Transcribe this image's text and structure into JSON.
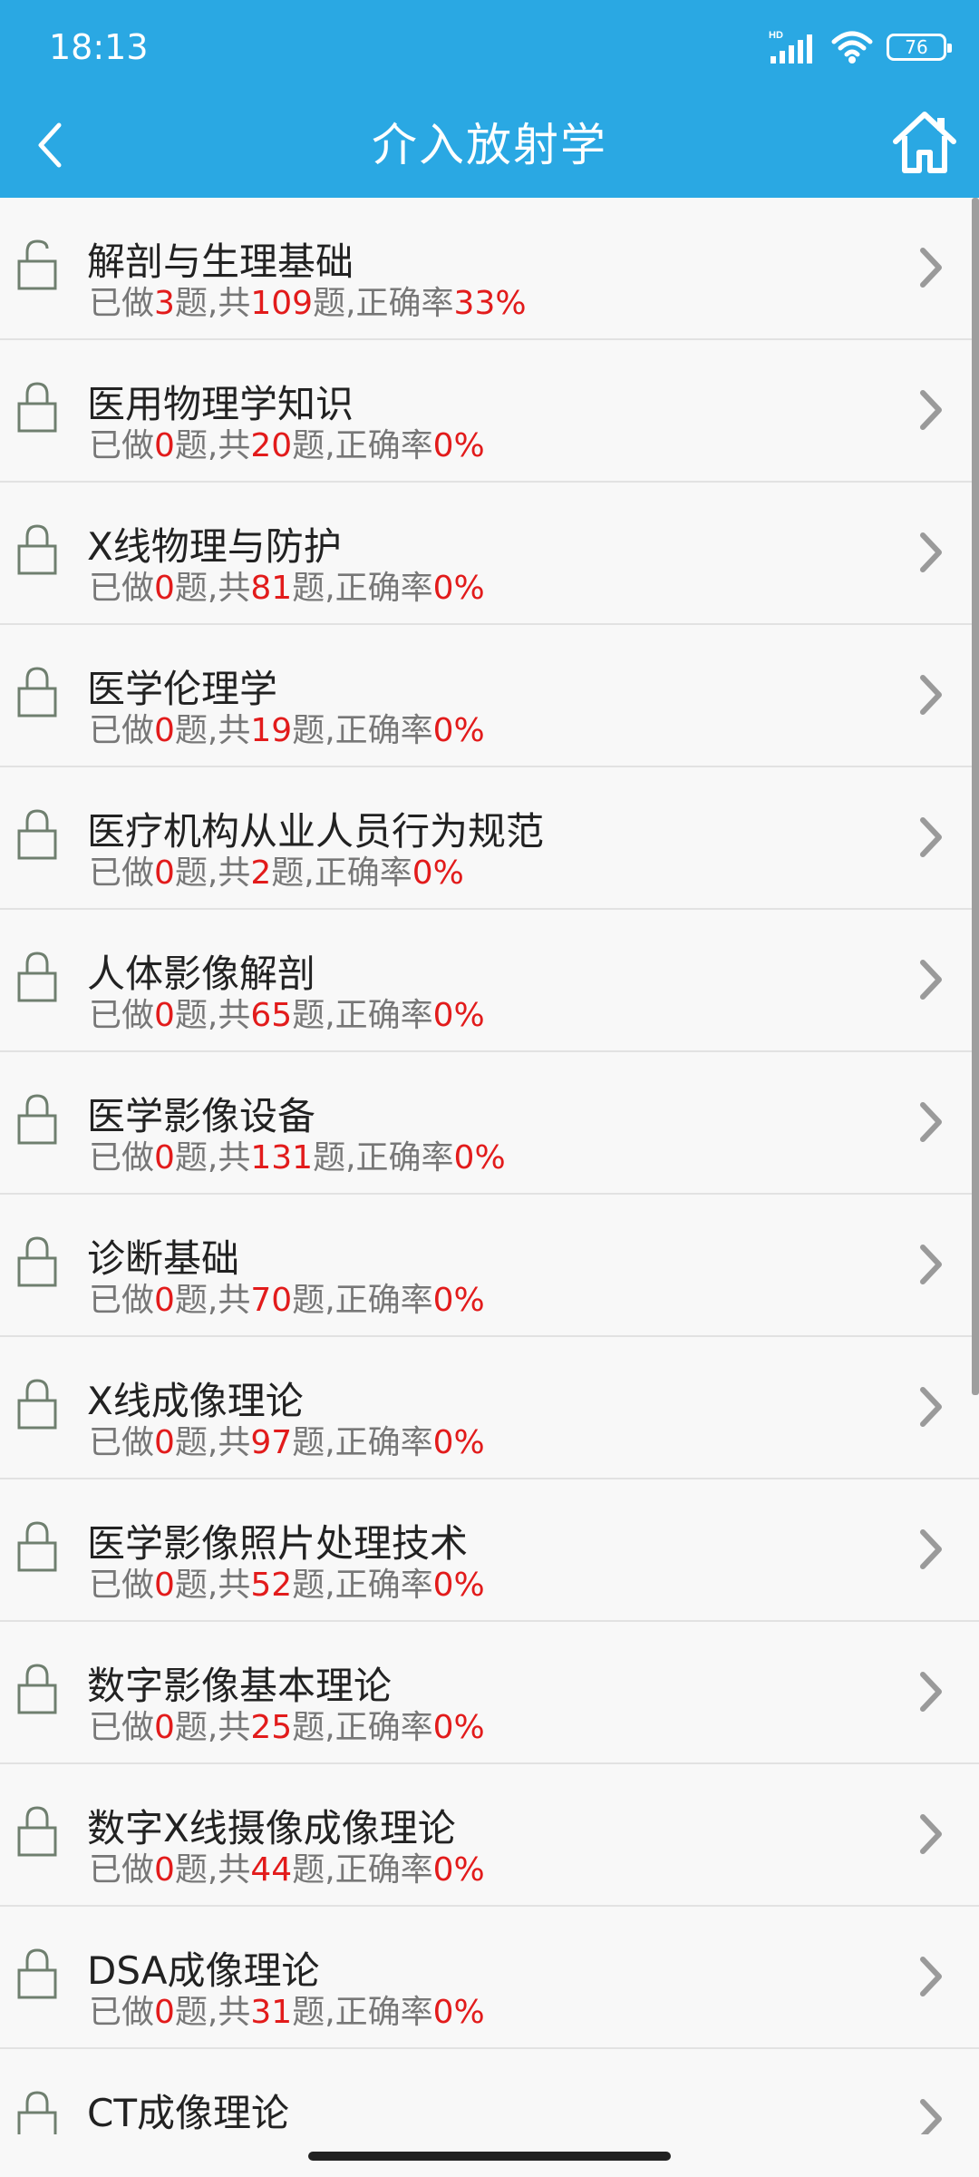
{
  "status_bar": {
    "time": "18:13",
    "battery": "76",
    "network_label": "HD"
  },
  "nav": {
    "title": "介入放射学"
  },
  "stats_labels": {
    "done_prefix": "已做",
    "done_suffix": "题,共",
    "total_suffix": "题,正确率"
  },
  "items": [
    {
      "title": "解剖与生理基础",
      "done": "3",
      "total": "109",
      "rate": "33%"
    },
    {
      "title": "医用物理学知识",
      "done": "0",
      "total": "20",
      "rate": "0%"
    },
    {
      "title": "X线物理与防护",
      "done": "0",
      "total": "81",
      "rate": "0%"
    },
    {
      "title": "医学伦理学",
      "done": "0",
      "total": "19",
      "rate": "0%"
    },
    {
      "title": "医疗机构从业人员行为规范",
      "done": "0",
      "total": "2",
      "rate": "0%"
    },
    {
      "title": "人体影像解剖",
      "done": "0",
      "total": "65",
      "rate": "0%"
    },
    {
      "title": "医学影像设备",
      "done": "0",
      "total": "131",
      "rate": "0%"
    },
    {
      "title": "诊断基础",
      "done": "0",
      "total": "70",
      "rate": "0%"
    },
    {
      "title": "X线成像理论",
      "done": "0",
      "total": "97",
      "rate": "0%"
    },
    {
      "title": "医学影像照片处理技术",
      "done": "0",
      "total": "52",
      "rate": "0%"
    },
    {
      "title": "数字影像基本理论",
      "done": "0",
      "total": "25",
      "rate": "0%"
    },
    {
      "title": "数字X线摄像成像理论",
      "done": "0",
      "total": "44",
      "rate": "0%"
    },
    {
      "title": "DSA成像理论",
      "done": "0",
      "total": "31",
      "rate": "0%"
    },
    {
      "title": "CT成像理论",
      "done": "",
      "total": "",
      "rate": ""
    }
  ],
  "colors": {
    "header_bg": "#2aa8e3",
    "accent_number": "#e21b1b",
    "list_bg": "#f8f8f8"
  }
}
